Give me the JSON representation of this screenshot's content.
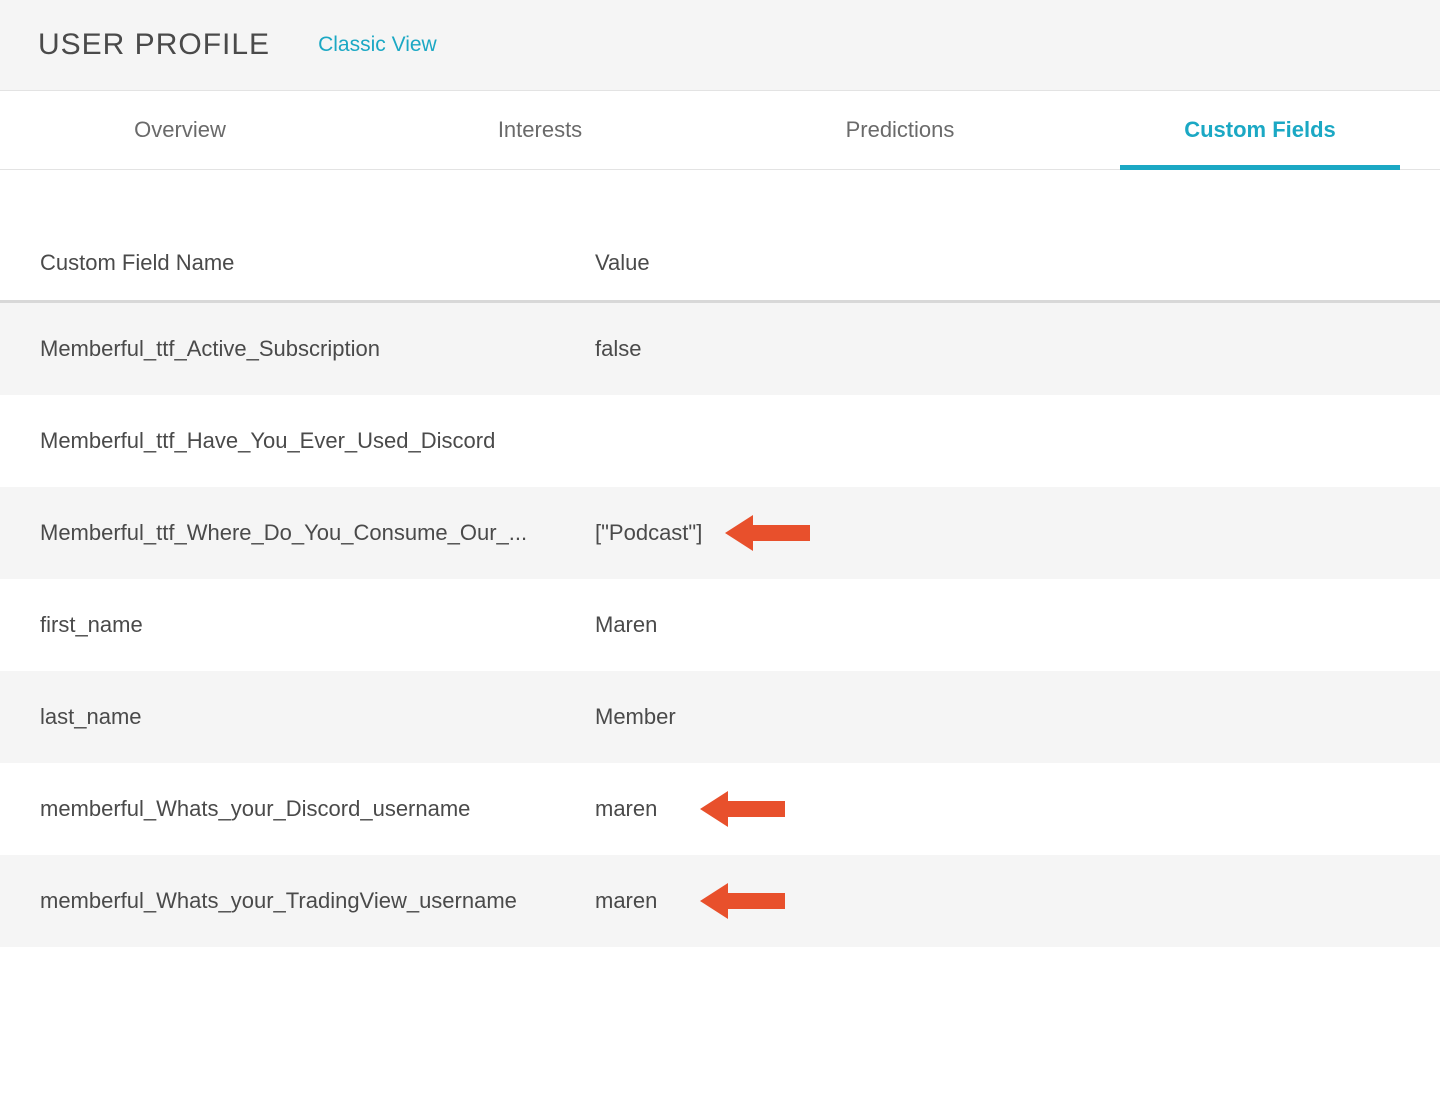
{
  "header": {
    "title": "USER PROFILE",
    "classic_view_label": "Classic View"
  },
  "tabs": [
    {
      "label": "Overview",
      "active": false
    },
    {
      "label": "Interests",
      "active": false
    },
    {
      "label": "Predictions",
      "active": false
    },
    {
      "label": "Custom Fields",
      "active": true
    }
  ],
  "table": {
    "headers": {
      "name": "Custom Field Name",
      "value": "Value"
    },
    "rows": [
      {
        "name": "Memberful_ttf_Active_Subscription",
        "value": "false",
        "arrow": false
      },
      {
        "name": "Memberful_ttf_Have_You_Ever_Used_Discord",
        "value": "",
        "arrow": false
      },
      {
        "name": "Memberful_ttf_Where_Do_You_Consume_Our_...",
        "value": "[\"Podcast\"]",
        "arrow": true,
        "arrowOffset": 0
      },
      {
        "name": "first_name",
        "value": "Maren",
        "arrow": false
      },
      {
        "name": "last_name",
        "value": "Member",
        "arrow": false
      },
      {
        "name": "memberful_Whats_your_Discord_username",
        "value": "maren",
        "arrow": true,
        "arrowOffset": 1
      },
      {
        "name": "memberful_Whats_your_TradingView_username",
        "value": "maren",
        "arrow": true,
        "arrowOffset": 1
      }
    ]
  },
  "colors": {
    "accent": "#1ba8c4",
    "arrow": "#e8502c"
  }
}
